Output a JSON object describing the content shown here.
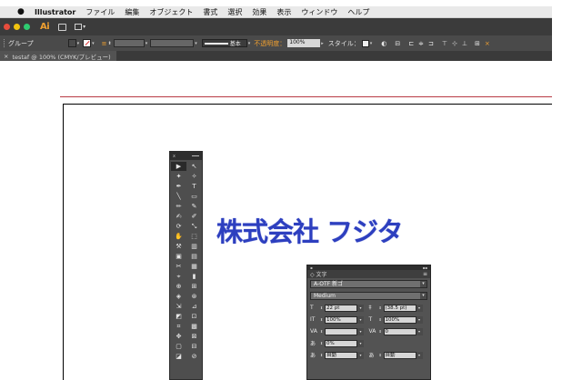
{
  "menubar": {
    "apple": "",
    "items": [
      "Illustrator",
      "ファイル",
      "編集",
      "オブジェクト",
      "書式",
      "選択",
      "効果",
      "表示",
      "ウィンドウ",
      "ヘルプ"
    ]
  },
  "app": {
    "logo": "Ai",
    "traffic_lights": [
      "#e74c3c",
      "#f1c40f",
      "#2ecc71"
    ]
  },
  "control_bar": {
    "selection_label": "グループ",
    "stroke_style_label": "基本",
    "opacity_label": "不透明度：",
    "opacity_value": "100%",
    "style_label": "スタイル："
  },
  "doc_tab": {
    "close": "×",
    "title": "testaf @ 100% (CMYK/プレビュー)"
  },
  "canvas": {
    "headline": "株式会社 フジタ",
    "headline_color": "#2d3fbf",
    "bleed_color": "#b83a44"
  },
  "tools_panel": {
    "close": "x",
    "tools": [
      "▶",
      "↖",
      "✦",
      "✧",
      "✒",
      "T",
      "╲",
      "▭",
      "✏",
      "✎",
      "✍",
      "✐",
      "⟳",
      "⤡",
      "✋",
      "⬚",
      "⚒",
      "▥",
      "▣",
      "▤",
      "✂",
      "▦",
      "⌖",
      "▮",
      "⊕",
      "⊞",
      "◈",
      "⊛",
      "⇲",
      "⊿",
      "◩",
      "⊡",
      "⌗",
      "▩",
      "✥",
      "⊠",
      "▢",
      "⊟",
      "◪",
      "⊘"
    ]
  },
  "character_panel": {
    "tab": "文字",
    "font_family": "A-OTF 新ゴ",
    "font_style": "Medium",
    "font_size": "22 pt",
    "leading": "(38.5 pt)",
    "vertical_scale": "100%",
    "horizontal_scale": "100%",
    "kerning": "",
    "tracking": "0",
    "baseline": "0%",
    "auto_label": "自動",
    "auto_label_2": "自動"
  }
}
